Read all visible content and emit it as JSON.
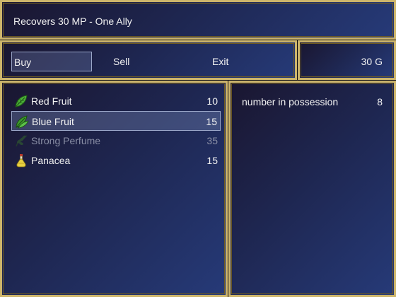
{
  "help": {
    "text": "Recovers 30 MP - One Ally"
  },
  "commands": [
    {
      "label": "Buy",
      "selected": true
    },
    {
      "label": "Sell",
      "selected": false
    },
    {
      "label": "Exit",
      "selected": false
    }
  ],
  "gold": {
    "amount": "30",
    "unit": "G"
  },
  "items": [
    {
      "name": "Red Fruit",
      "price": "10",
      "icon": "leaf-icon-red-fruit",
      "enabled": true,
      "selected": false
    },
    {
      "name": "Blue Fruit",
      "price": "15",
      "icon": "leaf-icon-blue-fruit",
      "enabled": true,
      "selected": true
    },
    {
      "name": "Strong Perfume",
      "price": "35",
      "icon": "herb-icon-strong-perfume",
      "enabled": false,
      "selected": false
    },
    {
      "name": "Panacea",
      "price": "15",
      "icon": "potion-icon-panacea",
      "enabled": true,
      "selected": false
    }
  ],
  "status": {
    "label": "number in possession",
    "count": "8"
  },
  "colors": {
    "border": "#cdb56b",
    "window_dark": "#1a1630",
    "window_light": "#263a78",
    "text": "#f2f2f2",
    "disabled_text": "#8a8fa6"
  }
}
